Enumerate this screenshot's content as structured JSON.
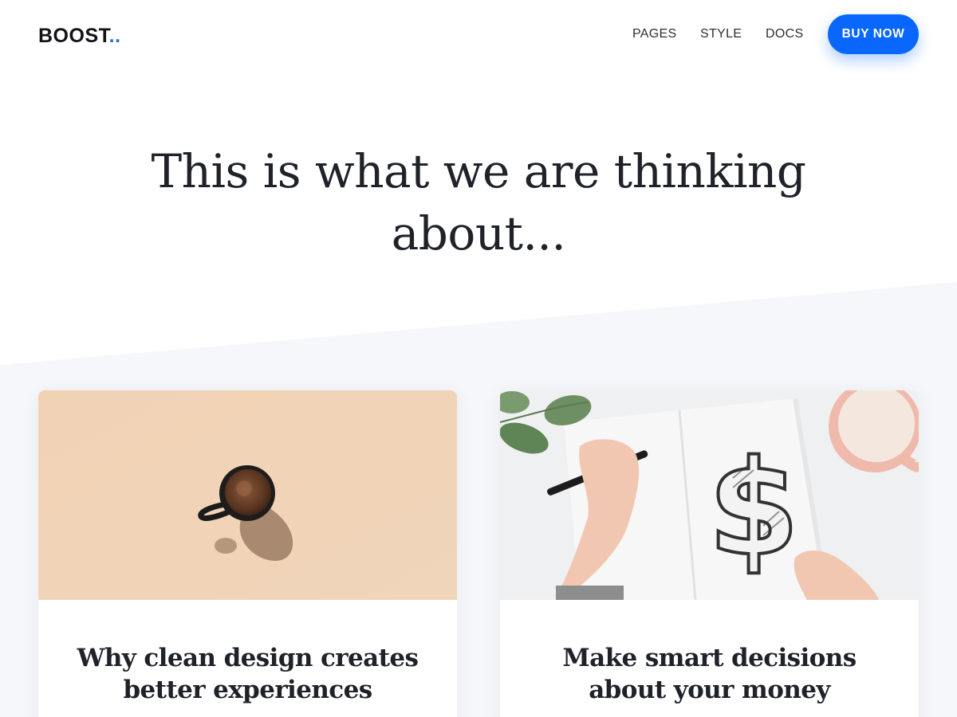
{
  "header": {
    "logo_text": "BOOST",
    "logo_dots": "..",
    "nav": {
      "pages": "PAGES",
      "style": "STYLE",
      "docs": "DOCS"
    },
    "cta_label": "BUY NOW"
  },
  "hero": {
    "title": "This is what we are thinking about..."
  },
  "cards": [
    {
      "title": "Why clean design creates better experiences",
      "image": "coffee-cup-photo"
    },
    {
      "title": "Make smart decisions about your money",
      "image": "dollar-sketch-photo"
    }
  ],
  "colors": {
    "accent": "#0a67fe",
    "logo_dots": "#1f6fe5",
    "section_bg": "#f6f7fa",
    "text_dark": "#1f2229"
  }
}
